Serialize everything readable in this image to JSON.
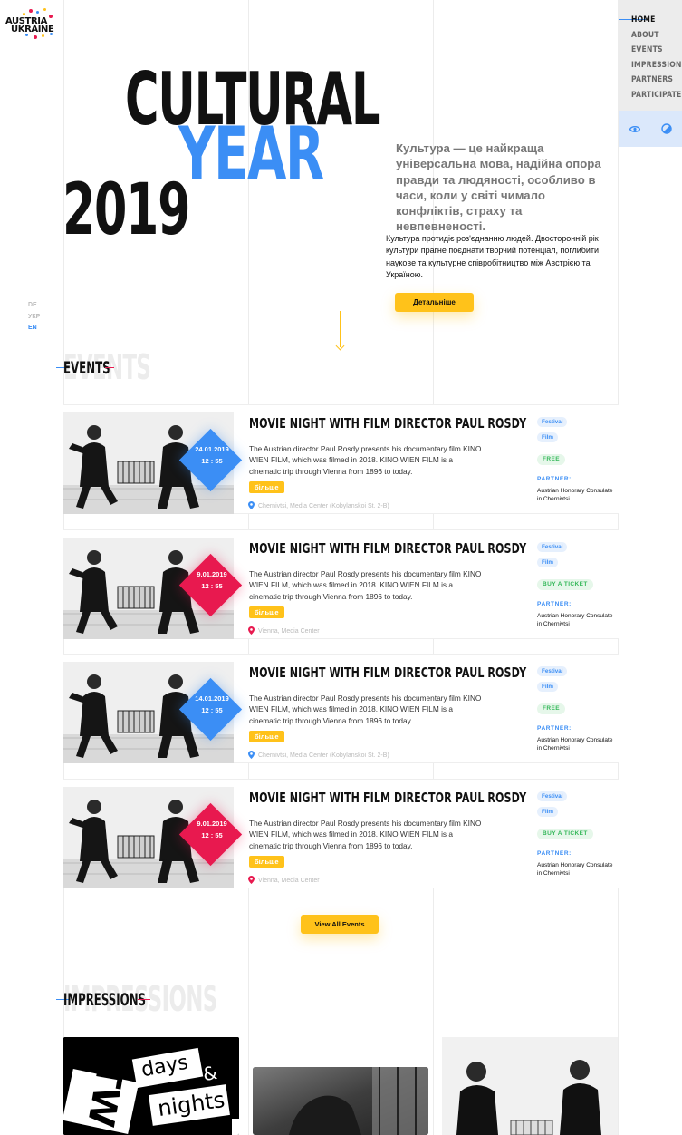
{
  "logo": {
    "line1": "AUSTRIA",
    "line2": "UKRAINE"
  },
  "nav": {
    "items": [
      {
        "label": "HOME"
      },
      {
        "label": "ABOUT"
      },
      {
        "label": "EVENTS"
      },
      {
        "label": "IMPRESSIONS"
      },
      {
        "label": "PARTNERS"
      },
      {
        "label": "PARTICIPATE"
      }
    ],
    "accessibility_icon": "eye-icon",
    "contrast_icon": "contrast-icon"
  },
  "lang": {
    "de": "DE",
    "ukr": "УКР",
    "en": "EN"
  },
  "hero": {
    "title_1": "CULTURAL",
    "title_2": "YEAR",
    "title_3": "2019",
    "lead": "Культура — це найкраща універсальна мова, надійна опора правди та людяності, особливо в часи, коли у світі чимало конфліктів, страху та невпевненості.",
    "text": "Культура протидіє роз'єднанню людей. Двосторонній рік культури прагне поєднати творчий потенціал, поглибити наукове та культурне співробітництво між Австрією та Україною.",
    "button": "Детальніше"
  },
  "events_section": {
    "ghost": "EVENTS",
    "title": "EVENTS"
  },
  "events": [
    {
      "title": "MOVIE NIGHT WITH FILM DIRECTOR PAUL ROSDY",
      "date": "24.01.2019",
      "time": "12 : 55",
      "description": "The Austrian director Paul Rosdy presents his documentary film KINO WIEN FILM, which was filmed in 2018. KINO WIEN FILM is a cinematic trip through Vienna from 1896 to today.",
      "more": "більше",
      "place": "Chernivtsi, Media Center (Kobylanskoi St. 2-B)",
      "tags": [
        "Festival",
        "Film"
      ],
      "price": "FREE",
      "partner_label": "PARTNER:",
      "partner": "Austrian Honorary Consulate in Chernivtsi"
    },
    {
      "title": "MOVIE NIGHT WITH FILM DIRECTOR PAUL ROSDY",
      "date": "9.01.2019",
      "time": "12 : 55",
      "description": "The Austrian director Paul Rosdy presents his documentary film KINO WIEN FILM, which was filmed in 2018. KINO WIEN FILM is a cinematic trip through Vienna from 1896 to today.",
      "more": "більше",
      "place": "Vienna, Media Center",
      "tags": [
        "Festival",
        "Film"
      ],
      "price": "BUY A TICKET",
      "partner_label": "PARTNER:",
      "partner": "Austrian Honorary Consulate in Chernivtsi"
    },
    {
      "title": "MOVIE NIGHT WITH FILM DIRECTOR PAUL ROSDY",
      "date": "14.01.2019",
      "time": "12 : 55",
      "description": "The Austrian director Paul Rosdy presents his documentary film KINO WIEN FILM, which was filmed in 2018. KINO WIEN FILM is a cinematic trip through Vienna from 1896 to today.",
      "more": "більше",
      "place": "Chernivtsi, Media Center (Kobylanskoi St. 2-B)",
      "tags": [
        "Festival",
        "Film"
      ],
      "price": "FREE",
      "partner_label": "PARTNER:",
      "partner": "Austrian Honorary Consulate in Chernivtsi"
    },
    {
      "title": "MOVIE NIGHT WITH FILM DIRECTOR PAUL ROSDY",
      "date": "9.01.2019",
      "time": "12 : 55",
      "description": "The Austrian director Paul Rosdy presents his documentary film KINO WIEN FILM, which was filmed in 2018. KINO WIEN FILM is a cinematic trip through Vienna from 1896 to today.",
      "more": "більше",
      "place": "Vienna, Media Center",
      "tags": [
        "Festival",
        "Film"
      ],
      "price": "BUY A TICKET",
      "partner_label": "PARTNER:",
      "partner": "Austrian Honorary Consulate in Chernivtsi"
    }
  ],
  "view_all": "View All Events",
  "impressions_section": {
    "ghost": "IMPRESSIONS",
    "title": "IMPRESSIONS"
  },
  "impressions": [
    {
      "word1": "TWO",
      "word2": "days",
      "word3": "&",
      "word4": "nights"
    }
  ],
  "colors": {
    "accent_blue": "#3b8ef5",
    "accent_red": "#e8194f",
    "accent_yellow": "#ffc21a",
    "green": "#35b85a"
  }
}
